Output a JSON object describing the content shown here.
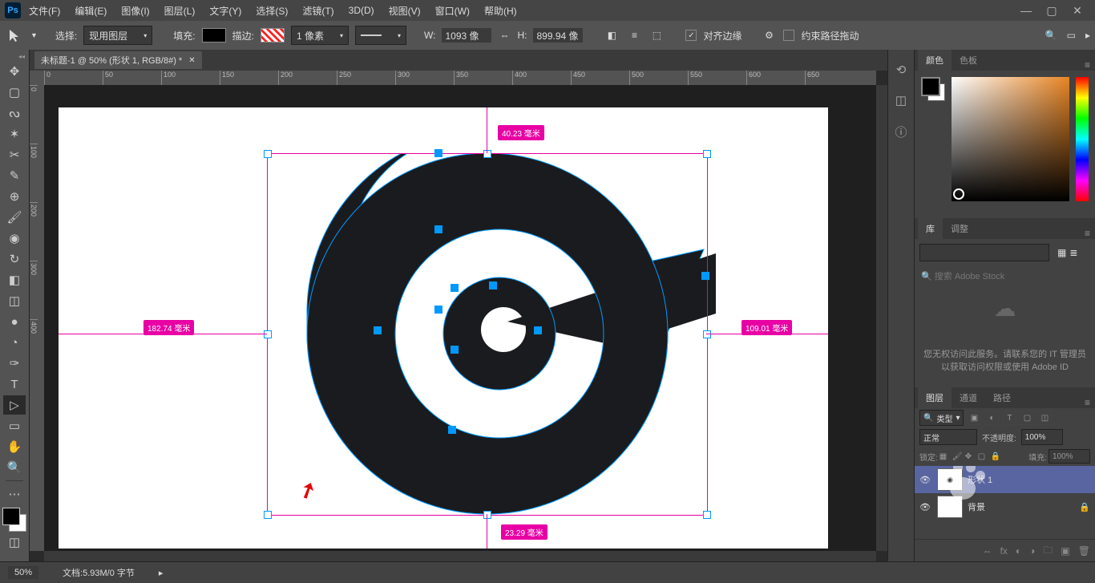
{
  "app": {
    "logo_text": "Ps"
  },
  "menu": {
    "items": [
      "文件(F)",
      "编辑(E)",
      "图像(I)",
      "图层(L)",
      "文字(Y)",
      "选择(S)",
      "滤镜(T)",
      "3D(D)",
      "视图(V)",
      "窗口(W)",
      "帮助(H)"
    ]
  },
  "options": {
    "select_label": "选择:",
    "layer_mode": "现用图层",
    "fill_label": "填充:",
    "stroke_label": "描边:",
    "stroke_width": "1 像素",
    "w_label": "W:",
    "w_value": "1093 像",
    "h_label": "H:",
    "h_value": "899.94 像",
    "align_edges": "对齐边缘",
    "constrain_path": "约束路径拖动"
  },
  "document": {
    "tab_title": "未标题-1 @ 50% (形状 1, RGB/8#) *"
  },
  "ruler_h": [
    "0",
    "50",
    "100",
    "150",
    "200",
    "250",
    "300",
    "350",
    "400",
    "450",
    "500",
    "550",
    "600",
    "650"
  ],
  "ruler_v": [
    "0",
    "100",
    "200",
    "300",
    "400"
  ],
  "measurements": {
    "top": "40.23 毫米",
    "left": "182.74 毫米",
    "right": "109.01 毫米",
    "bottom": "23.29 毫米"
  },
  "panels": {
    "color": {
      "tab_color": "颜色",
      "tab_swatches": "色板"
    },
    "libraries": {
      "tab_lib": "库",
      "tab_adjust": "调整",
      "search_placeholder": "搜索 Adobe Stock",
      "message": "您无权访问此服务。请联系您的 IT 管理员以获取访问权限或使用 Adobe ID"
    },
    "layers": {
      "tab_layers": "图层",
      "tab_channels": "通道",
      "tab_paths": "路径",
      "filter_kind": "类型",
      "blend_mode": "正常",
      "opacity_label": "不透明度:",
      "opacity_value": "100%",
      "lock_label": "锁定:",
      "fill_label": "填充:",
      "fill_value": "100%",
      "rows": [
        {
          "name": "形状 1"
        },
        {
          "name": "背景"
        }
      ]
    }
  },
  "status": {
    "zoom": "50%",
    "doc_info": "文档:5.93M/0 字节"
  }
}
